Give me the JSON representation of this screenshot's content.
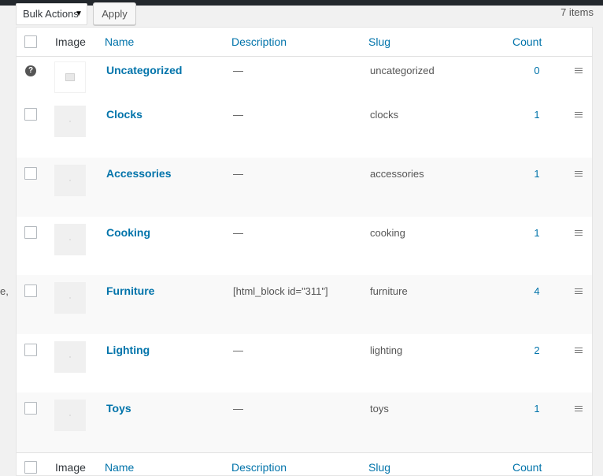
{
  "bulk_actions": {
    "label": "Bulk Actions"
  },
  "apply_label": "Apply",
  "items_count": "7 items",
  "edge_fragment": "e,",
  "columns": {
    "image": "Image",
    "name": "Name",
    "description": "Description",
    "slug": "Slug",
    "count": "Count"
  },
  "rows": [
    {
      "name": "Uncategorized",
      "description": "—",
      "slug": "uncategorized",
      "count": "0"
    },
    {
      "name": "Clocks",
      "description": "—",
      "slug": "clocks",
      "count": "1"
    },
    {
      "name": "Accessories",
      "description": "—",
      "slug": "accessories",
      "count": "1"
    },
    {
      "name": "Cooking",
      "description": "—",
      "slug": "cooking",
      "count": "1"
    },
    {
      "name": "Furniture",
      "description": "[html_block id=\"311\"]",
      "slug": "furniture",
      "count": "4"
    },
    {
      "name": "Lighting",
      "description": "—",
      "slug": "lighting",
      "count": "2"
    },
    {
      "name": "Toys",
      "description": "—",
      "slug": "toys",
      "count": "1"
    }
  ],
  "icons": {
    "help": "question-circle-icon",
    "image_placeholder": "image-placeholder-icon",
    "drag_handle": "drag-handle-icon"
  },
  "colors": {
    "link": "#0073aa",
    "topbar": "#23282d",
    "text": "#32373c"
  }
}
